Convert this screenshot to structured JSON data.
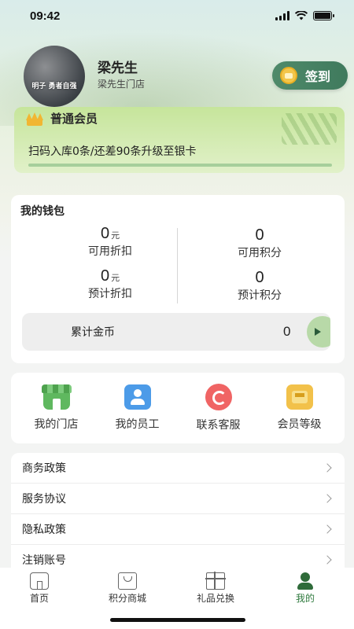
{
  "status_bar": {
    "time": "09:42"
  },
  "profile": {
    "name": "梁先生",
    "store": "梁先生门店",
    "avatar_text": "明子 勇者自强",
    "checkin_label": "签到"
  },
  "member": {
    "level": "普通会员",
    "progress_text": "扫码入库0条/还差90条升级至银卡",
    "progress": 0.0
  },
  "wallet": {
    "title": "我的钱包",
    "available_discount": {
      "value": "0",
      "unit": "元",
      "label": "可用折扣"
    },
    "available_points": {
      "value": "0",
      "label": "可用积分"
    },
    "estimated_discount": {
      "value": "0",
      "unit": "元",
      "label": "预计折扣"
    },
    "estimated_points": {
      "value": "0",
      "label": "预计积分"
    },
    "coins": {
      "label": "累计金币",
      "value": "0"
    }
  },
  "shortcuts": [
    {
      "label": "我的门店",
      "icon": "store-icon"
    },
    {
      "label": "我的员工",
      "icon": "staff-icon"
    },
    {
      "label": "联系客服",
      "icon": "customer-service-icon"
    },
    {
      "label": "会员等级",
      "icon": "member-level-icon"
    }
  ],
  "menu": [
    {
      "label": "商务政策"
    },
    {
      "label": "服务协议"
    },
    {
      "label": "隐私政策"
    },
    {
      "label": "注销账号"
    }
  ],
  "tab_bar": {
    "tabs": [
      {
        "label": "首页",
        "icon": "home-icon"
      },
      {
        "label": "积分商城",
        "icon": "shopping-bag-icon"
      },
      {
        "label": "礼品兑换",
        "icon": "gift-icon"
      },
      {
        "label": "我的",
        "icon": "user-icon"
      }
    ],
    "active_index": 3,
    "active_color": "#2f7a3e"
  },
  "colors": {
    "brand_green": "#3f7a5d",
    "member_card": "#c6e59b",
    "progress_fill": "#3d8a55"
  }
}
